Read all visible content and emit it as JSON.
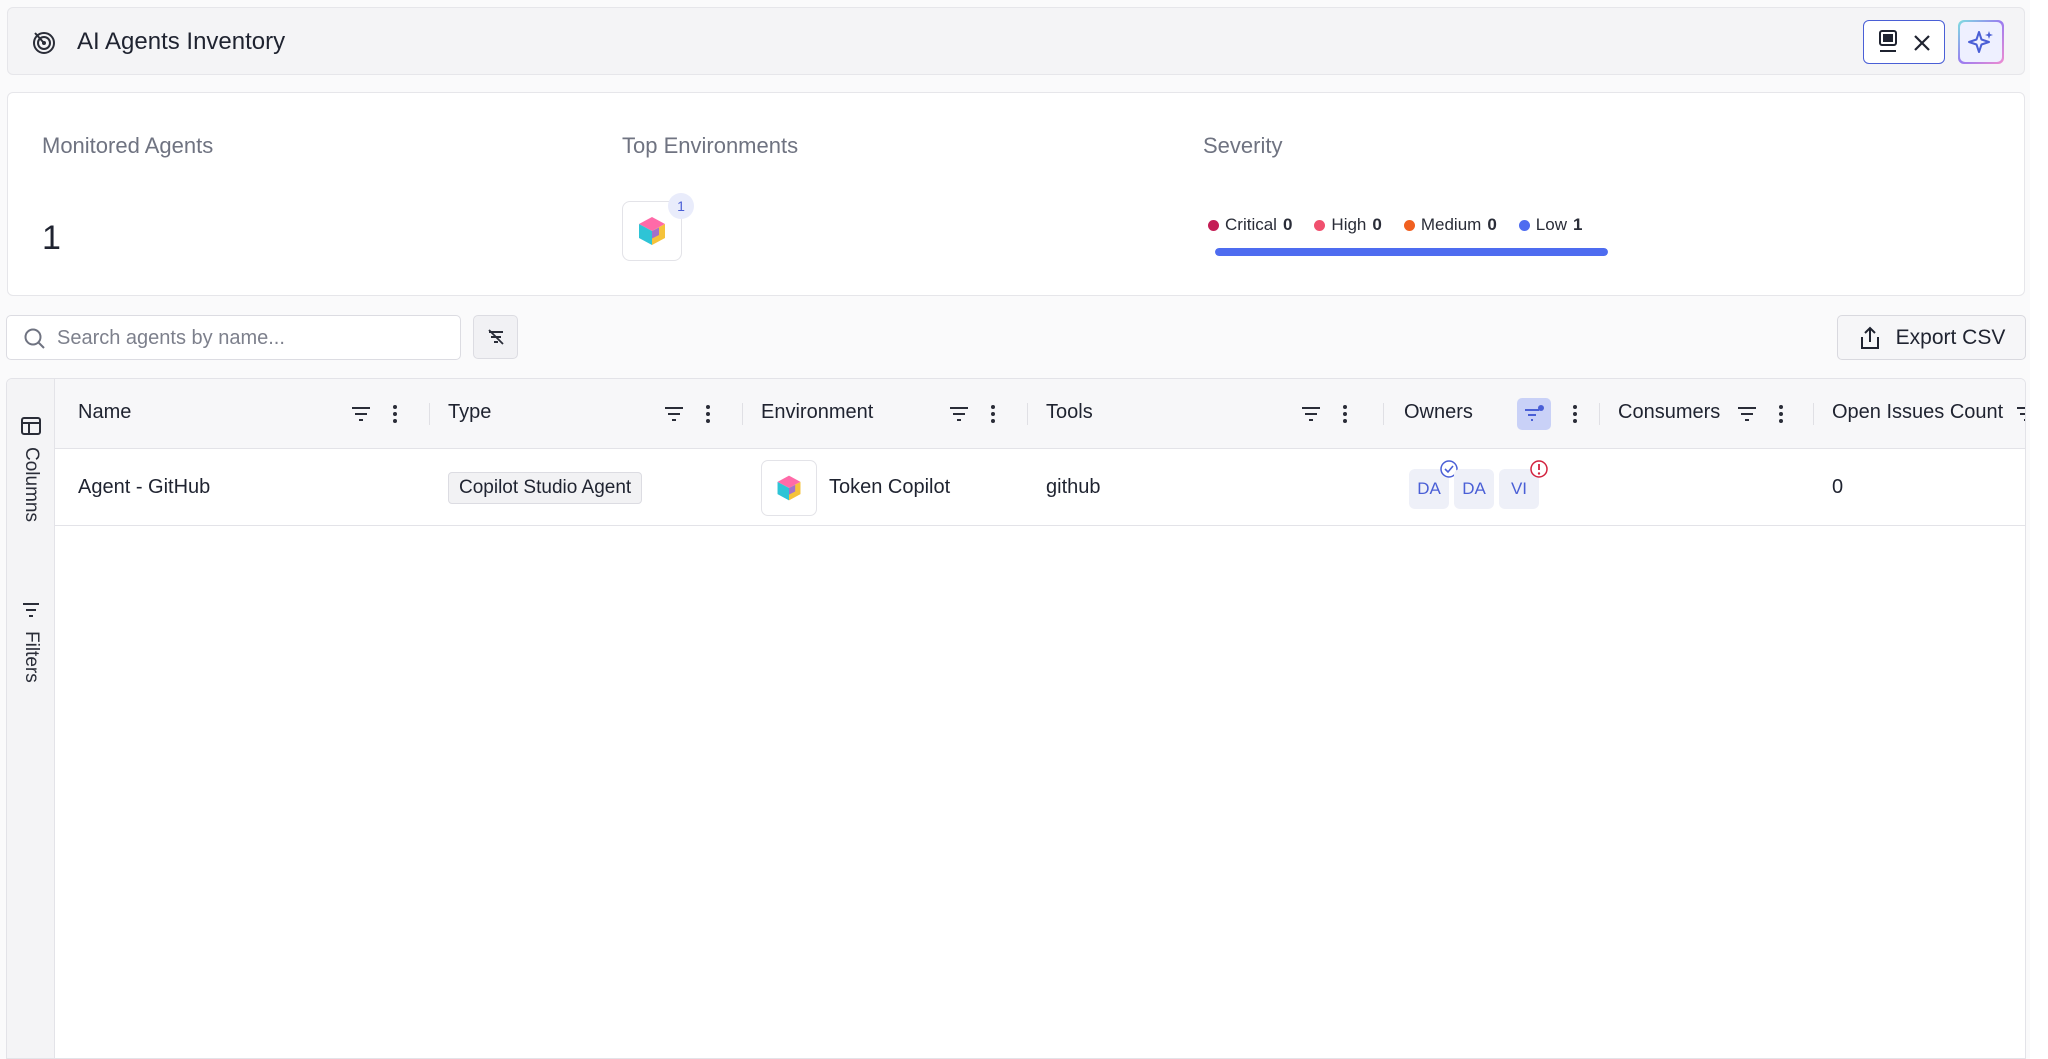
{
  "header": {
    "title": "AI Agents Inventory"
  },
  "stats": {
    "monitored_label": "Monitored Agents",
    "monitored_value": "1",
    "environments_label": "Top Environments",
    "environment_count": "1",
    "severity_label": "Severity",
    "severity": [
      {
        "label": "Critical",
        "count": "0",
        "color": "#c41e55"
      },
      {
        "label": "High",
        "count": "0",
        "color": "#f0506e"
      },
      {
        "label": "Medium",
        "count": "0",
        "color": "#f06020"
      },
      {
        "label": "Low",
        "count": "1",
        "color": "#4e6cf0"
      }
    ],
    "severity_low_fraction": 1.0
  },
  "toolbar": {
    "search_placeholder": "Search agents by name...",
    "export_label": "Export CSV"
  },
  "rail": {
    "columns_label": "Columns",
    "filters_label": "Filters"
  },
  "table": {
    "columns": [
      "Name",
      "Type",
      "Environment",
      "Tools",
      "Owners",
      "Consumers",
      "Open Issues Count"
    ],
    "rows": [
      {
        "name": "Agent - GitHub",
        "type": "Copilot Studio Agent",
        "environment": "Token Copilot",
        "tools": "github",
        "owners": [
          "DA",
          "DA",
          "VI"
        ],
        "consumers": "",
        "open_issues": "0"
      }
    ]
  },
  "colors": {
    "accent": "#4a5fd6",
    "severity_bar": "#4e6cf0"
  }
}
